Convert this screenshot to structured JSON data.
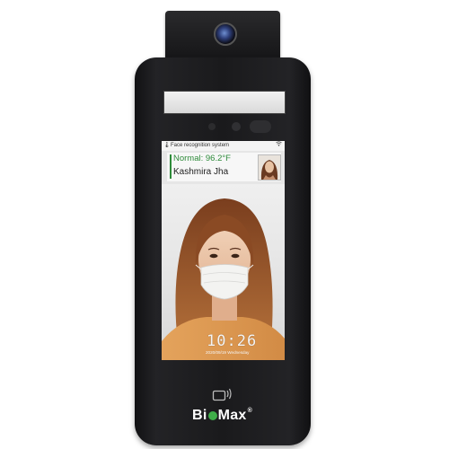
{
  "screen": {
    "status_title": "Face recognition system",
    "status_icon": "temperature-icon",
    "temperature_text": "Normal: 96.2°F",
    "person_name": "Kashmira Jha",
    "clock_time": "10:26",
    "clock_date": "2020/09/19 Wednesday"
  },
  "device": {
    "brand_prefix": "Bi",
    "brand_suffix": "Max",
    "brand_reg": "®"
  },
  "colors": {
    "normal_status": "#2e8b3a",
    "brand_dot": "#3fae49"
  }
}
